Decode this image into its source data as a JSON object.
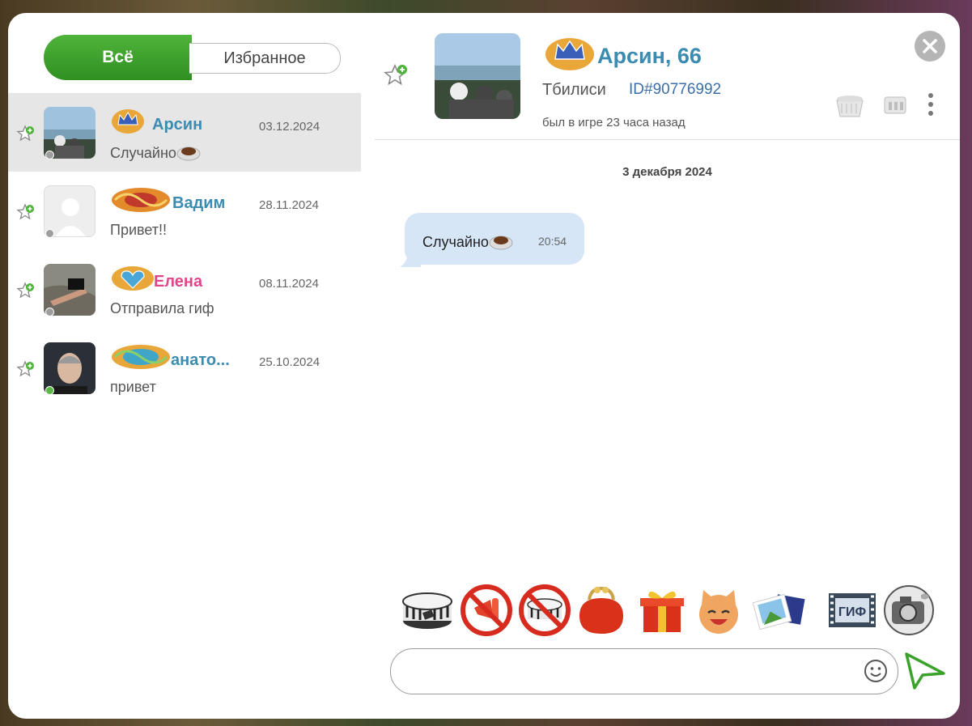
{
  "tabs": {
    "all": "Всё",
    "favorites": "Избранное"
  },
  "contacts": [
    {
      "name": "Арсин",
      "date": "03.12.2024",
      "message": "Случайно",
      "name_color": "#3c8bb1",
      "status_color": "#9e9e9e"
    },
    {
      "name": "Вадим",
      "date": "28.11.2024",
      "message": "Привет!!",
      "name_color": "#3c8bb1",
      "status_color": "#9e9e9e"
    },
    {
      "name": "Елена",
      "date": "08.11.2024",
      "message": "Отправила гиф",
      "name_color": "#e0468a",
      "status_color": "#9e9e9e"
    },
    {
      "name": "анато...",
      "date": "25.10.2024",
      "message": "привет",
      "name_color": "#3c8bb1",
      "status_color": "#5bb845"
    }
  ],
  "header": {
    "name": "Арсин, 66",
    "city": "Тбилиси",
    "id": "ID#90776992",
    "last_seen": "был в игре 23 часа назад"
  },
  "chat": {
    "date_separator": "3 декабря 2024",
    "messages": [
      {
        "text": "Случайно",
        "time": "20:54"
      }
    ]
  },
  "composer": {
    "value": "",
    "placeholder": ""
  },
  "toolbar_icons": [
    "chat-ban-icon",
    "no-megaphone-icon",
    "no-chat-ban-icon",
    "purse-icon",
    "gift-icon",
    "cat-emoji-icon",
    "photos-icon",
    "gif-film-icon",
    "camera-icon"
  ],
  "colors": {
    "accent_green": "#3fa12e",
    "name_blue": "#3c8bb1",
    "bubble": "#d6e6f7"
  }
}
